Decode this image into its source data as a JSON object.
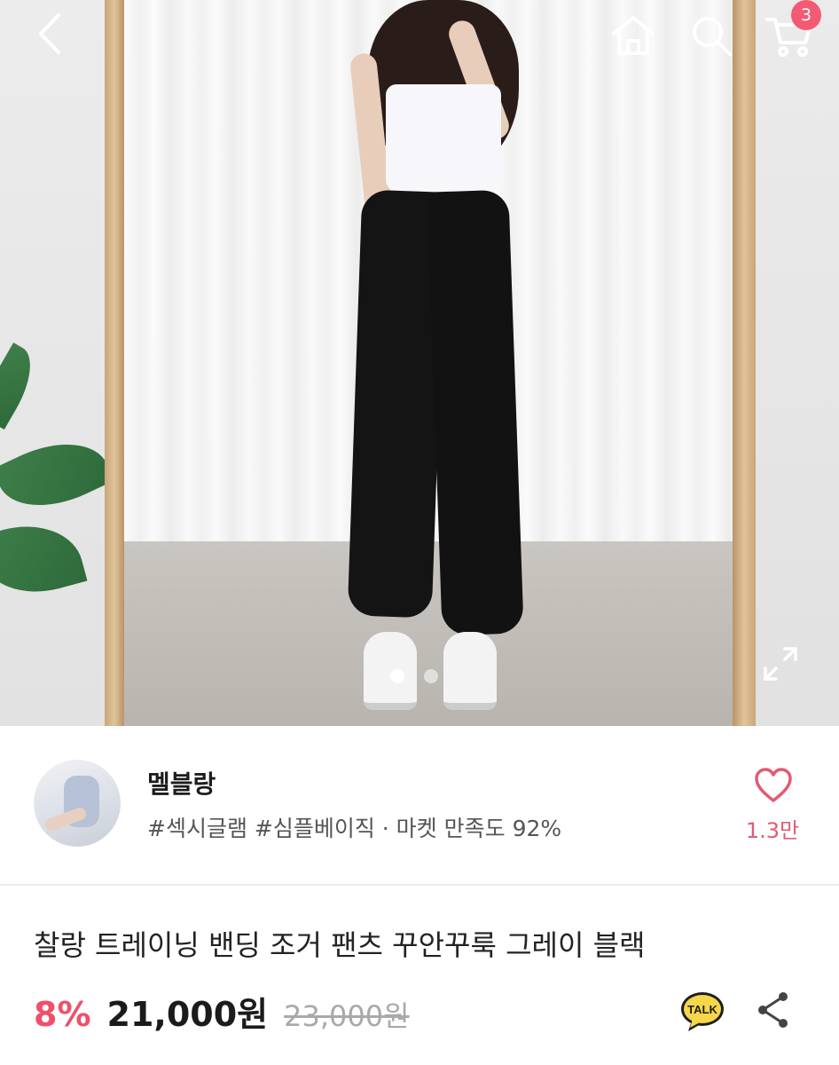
{
  "header": {
    "back_icon": "chevron-left-icon",
    "home_icon": "home-icon",
    "search_icon": "search-icon",
    "cart_icon": "cart-icon",
    "cart_badge": "3"
  },
  "hero": {
    "image_count": 2,
    "active_index": 1,
    "expand_icon": "expand-icon"
  },
  "store": {
    "name": "멜블랑",
    "tags": "#섹시글램 #심플베이직 · 마켓 만족도 92%",
    "like_count": "1.3만",
    "like_icon": "heart-icon"
  },
  "product": {
    "title": "찰랑 트레이닝 밴딩 조거 팬츠 꾸안꾸룩 그레이 블랙",
    "discount": "8%",
    "price": "21,000원",
    "original_price": "23,000원"
  },
  "actions": {
    "talk_label": "TALK",
    "share_icon": "share-icon"
  },
  "colors": {
    "accent": "#f04f6a",
    "badge": "#f35a73",
    "like": "#e05b74"
  }
}
